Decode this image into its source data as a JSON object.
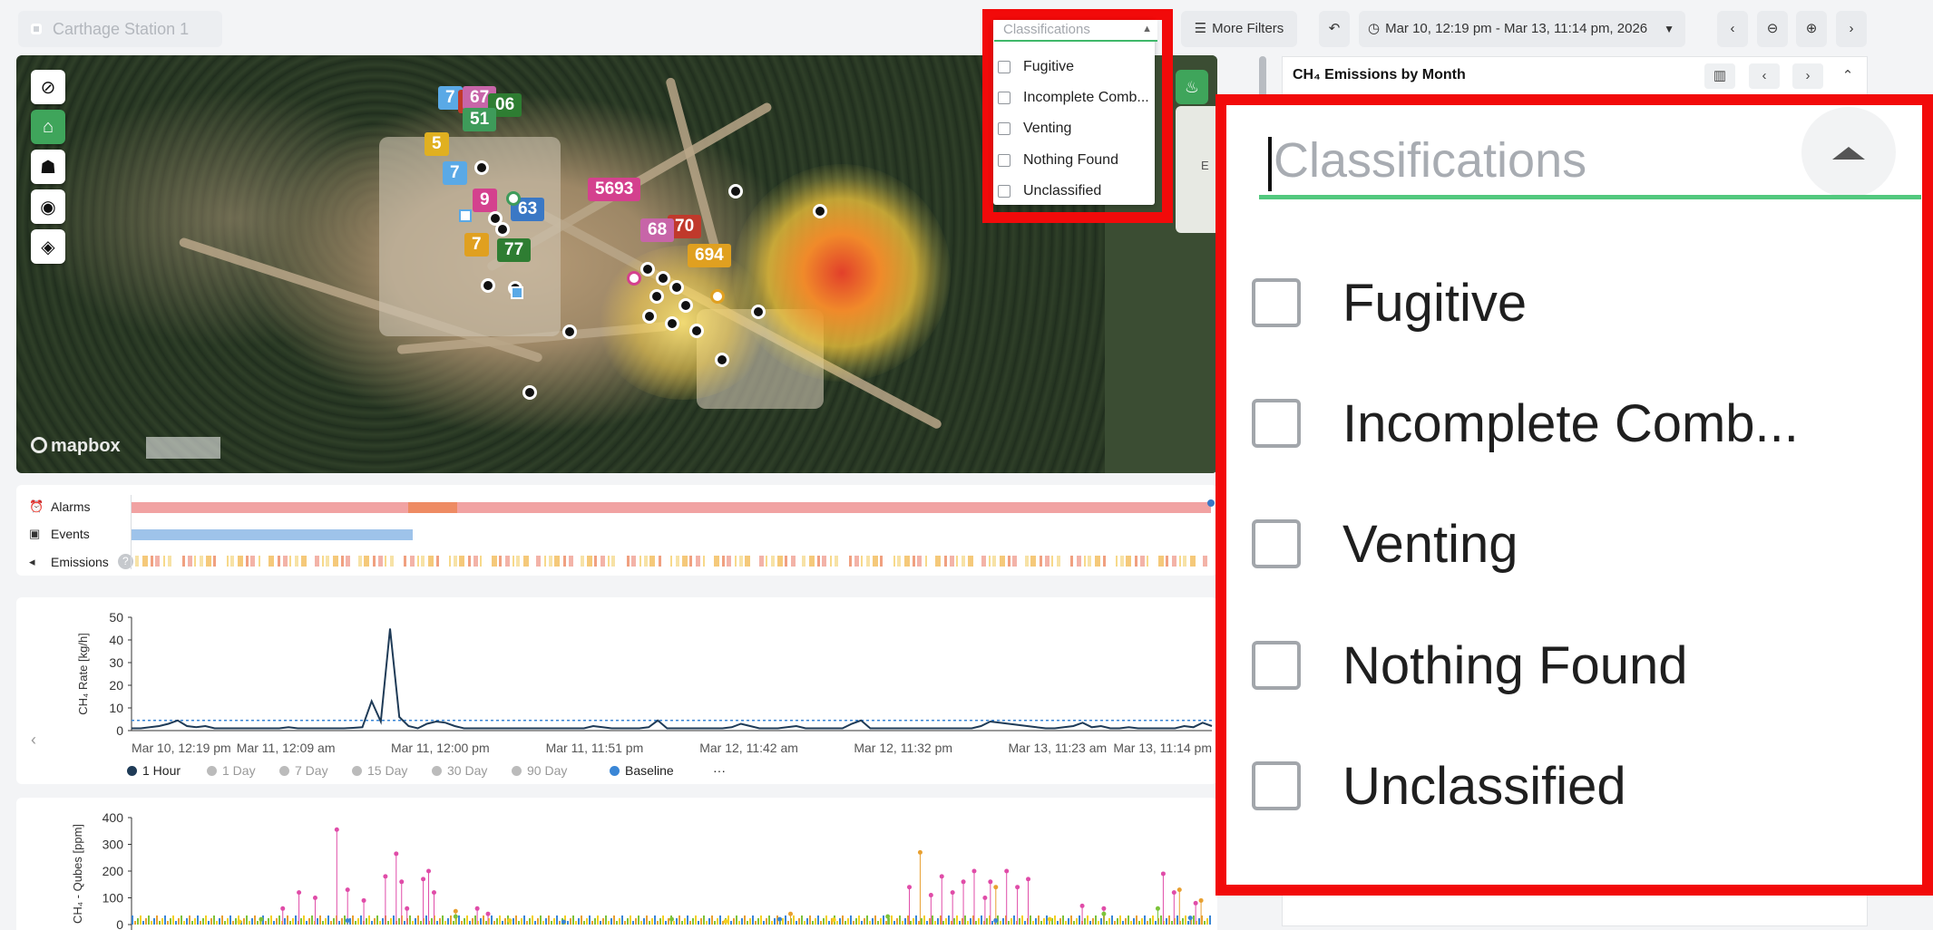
{
  "top_bar": {
    "site_name": "Carthage Station 1",
    "more_filters_label": "More Filters",
    "date_range": "Mar 10, 12:19 pm - Mar 13, 11:14 pm, 2026"
  },
  "classifications": {
    "placeholder": "Classifications",
    "options": [
      "Fugitive",
      "Incomplete Comb...",
      "Venting",
      "Nothing Found",
      "Unclassified"
    ]
  },
  "map": {
    "attribution": "mapbox",
    "side_letter": "E",
    "tags": [
      {
        "text": "7",
        "color": "#5aa9e6"
      },
      {
        "text": "7",
        "color": "#c0392b"
      },
      {
        "text": "67",
        "color": "#c765a8"
      },
      {
        "text": "06",
        "color": "#2e7d32"
      },
      {
        "text": "51",
        "color": "#3e9b5a"
      },
      {
        "text": "5",
        "color": "#e0b020"
      },
      {
        "text": "7",
        "color": "#5aa9e6"
      },
      {
        "text": "9",
        "color": "#d4418e"
      },
      {
        "text": "63",
        "color": "#3a78c5"
      },
      {
        "text": "5693",
        "color": "#d4418e"
      },
      {
        "text": "70",
        "color": "#c0392b"
      },
      {
        "text": "68",
        "color": "#c765a8"
      },
      {
        "text": "7",
        "color": "#e0a020"
      },
      {
        "text": "77",
        "color": "#2e7d32"
      },
      {
        "text": "694",
        "color": "#e0a020"
      }
    ]
  },
  "right_panel": {
    "title": "CH₄ Emissions by Month"
  },
  "timeline": {
    "rows": [
      {
        "label": "Alarms",
        "icon": "alarm-icon"
      },
      {
        "label": "Events",
        "icon": "calendar-icon"
      },
      {
        "label": "Emissions",
        "icon": "speaker-icon"
      }
    ],
    "help_icon": "?"
  },
  "rate_chart": {
    "legend": [
      {
        "label": "1 Hour",
        "active": true,
        "color": "#1f3b57"
      },
      {
        "label": "1 Day",
        "active": false,
        "color": "#bbbbbb"
      },
      {
        "label": "7 Day",
        "active": false,
        "color": "#bbbbbb"
      },
      {
        "label": "15 Day",
        "active": false,
        "color": "#bbbbbb"
      },
      {
        "label": "30 Day",
        "active": false,
        "color": "#bbbbbb"
      },
      {
        "label": "90 Day",
        "active": false,
        "color": "#bbbbbb"
      },
      {
        "label": "Baseline",
        "active": true,
        "color": "#3a86d6"
      }
    ],
    "more_label": "···"
  },
  "chart_data": [
    {
      "type": "line",
      "ylabel": "CH₄ Rate [kg/h]",
      "ylim": [
        0,
        50
      ],
      "yticks": [
        0,
        10,
        20,
        30,
        40,
        50
      ],
      "xticks": [
        "Mar 10, 12:19 pm",
        "Mar 11, 12:09 am",
        "Mar 11, 12:00 pm",
        "Mar 11, 11:51 pm",
        "Mar 12, 11:42 am",
        "Mar 12, 11:32 pm",
        "Mar 13, 11:23 am",
        "Mar 13, 11:14 pm"
      ],
      "baseline": 4.5,
      "values": [
        1,
        1,
        1.5,
        2,
        3,
        4.5,
        2,
        1.5,
        2,
        1,
        1,
        1,
        1,
        1,
        1,
        1,
        1,
        1.5,
        1,
        1,
        1,
        1,
        1,
        1,
        1.2,
        1.5,
        13,
        4,
        45,
        6,
        2,
        1,
        3,
        4,
        3.5,
        2,
        1,
        1,
        1,
        1,
        1,
        1,
        1,
        1,
        1,
        1,
        1,
        1,
        1,
        1,
        2,
        1.5,
        1,
        1,
        1,
        1,
        1.5,
        4.5,
        1,
        1,
        1,
        1,
        1,
        1,
        1,
        1.5,
        3,
        2,
        1,
        1,
        1,
        1.5,
        2,
        1,
        1,
        1,
        1,
        1,
        3,
        4.5,
        1,
        1,
        1,
        1,
        1,
        1,
        1,
        1,
        1,
        1,
        1,
        1,
        2,
        4,
        3.5,
        3,
        2.5,
        2,
        1.5,
        1,
        1,
        1.5,
        2,
        3.5,
        1.5,
        2,
        1,
        1,
        1.5,
        1,
        1,
        1,
        1,
        1,
        2,
        1.5,
        3.5,
        2
      ]
    },
    {
      "type": "scatter",
      "ylabel": "CH₄ - Qubes [ppm]",
      "ylim": [
        0,
        400
      ],
      "yticks": [
        0,
        100,
        200,
        300,
        400
      ],
      "series": [
        {
          "color": "#e04ca8",
          "values": [
            [
              0.19,
              355
            ],
            [
              0.25,
              160
            ],
            [
              0.245,
              265
            ],
            [
              0.255,
              60
            ],
            [
              0.27,
              170
            ],
            [
              0.275,
              200
            ],
            [
              0.155,
              120
            ],
            [
              0.17,
              100
            ],
            [
              0.2,
              130
            ],
            [
              0.215,
              90
            ],
            [
              0.235,
              180
            ],
            [
              0.28,
              120
            ],
            [
              0.32,
              60
            ],
            [
              0.33,
              40
            ],
            [
              0.14,
              60
            ],
            [
              0.72,
              140
            ],
            [
              0.74,
              110
            ],
            [
              0.77,
              160
            ],
            [
              0.79,
              100
            ],
            [
              0.81,
              200
            ],
            [
              0.82,
              140
            ],
            [
              0.83,
              170
            ],
            [
              0.955,
              190
            ],
            [
              0.965,
              120
            ],
            [
              0.88,
              70
            ],
            [
              0.9,
              60
            ],
            [
              0.985,
              80
            ],
            [
              0.75,
              180
            ],
            [
              0.76,
              120
            ],
            [
              0.78,
              200
            ],
            [
              0.795,
              160
            ]
          ]
        },
        {
          "color": "#e8a030",
          "values": [
            [
              0.73,
              270
            ],
            [
              0.8,
              140
            ],
            [
              0.97,
              130
            ],
            [
              0.99,
              90
            ],
            [
              0.3,
              50
            ],
            [
              0.61,
              40
            ]
          ]
        },
        {
          "color": "#7cc33a",
          "values": [
            [
              0.12,
              20
            ],
            [
              0.3,
              30
            ],
            [
              0.5,
              20
            ],
            [
              0.7,
              30
            ],
            [
              0.9,
              40
            ],
            [
              0.95,
              60
            ]
          ]
        },
        {
          "color": "#3a86d6",
          "values": [
            [
              0.2,
              15
            ],
            [
              0.4,
              10
            ],
            [
              0.6,
              20
            ],
            [
              0.8,
              15
            ],
            [
              0.98,
              25
            ]
          ]
        },
        {
          "color": "#f4d020",
          "values": [
            [
              0.1,
              10
            ],
            [
              0.35,
              15
            ],
            [
              0.55,
              12
            ],
            [
              0.65,
              18
            ],
            [
              0.85,
              20
            ]
          ]
        }
      ]
    }
  ]
}
